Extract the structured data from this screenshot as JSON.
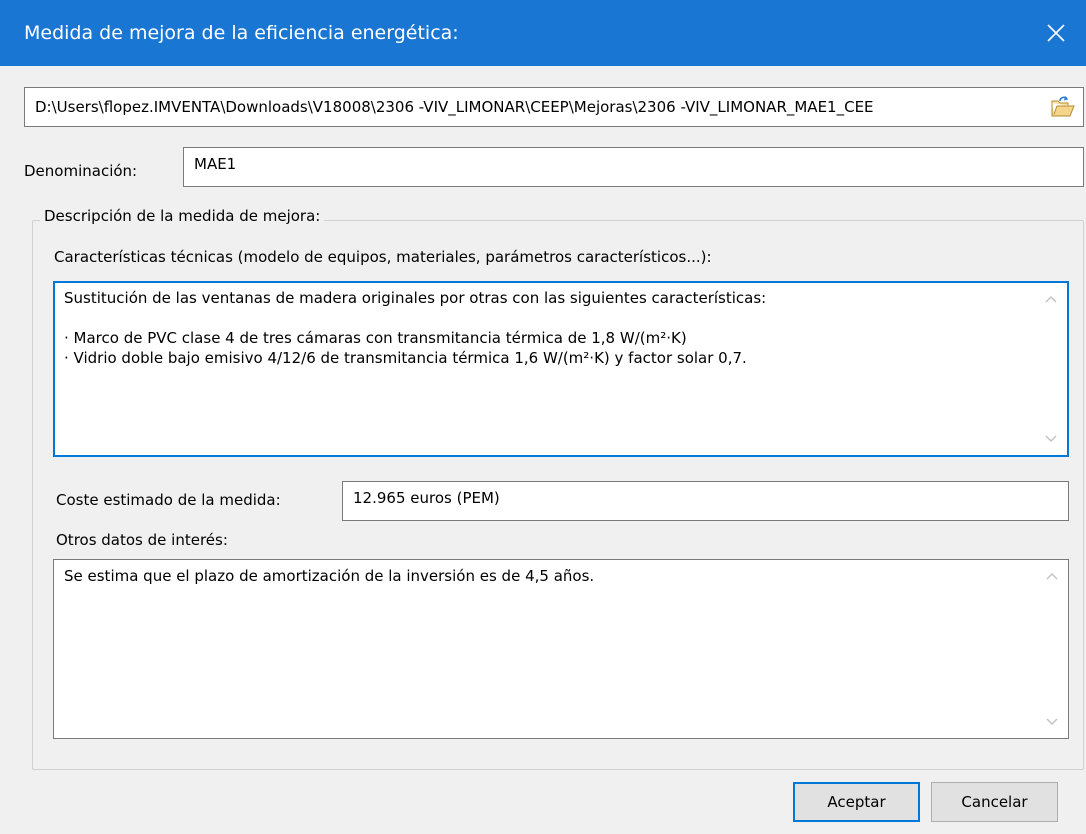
{
  "window": {
    "title": "Medida de mejora de la eficiencia energética:",
    "close_icon": "close-icon",
    "accent_color": "#1976d2"
  },
  "path": {
    "value": "D:\\Users\\flopez.IMVENTA\\Downloads\\V18008\\2306 -VIV_LIMONAR\\CEEP\\Mejoras\\2306 -VIV_LIMONAR_MAE1_CEE",
    "browse_icon": "folder-open-icon"
  },
  "denominacion": {
    "label": "Denominación:",
    "value": "MAE1"
  },
  "descripcion": {
    "group_title": "Descripción de la medida de mejora:",
    "caracteristicas_label": "Características técnicas (modelo de equipos, materiales, parámetros característicos...):",
    "caracteristicas_lines": [
      "Sustitución de las ventanas de madera originales por otras con las siguientes características:",
      "",
      "· Marco de PVC clase 4 de tres cámaras con transmitancia térmica de 1,8 W/(m²·K)",
      "· Vidrio doble bajo emisivo 4/12/6 de transmitancia térmica 1,6 W/(m²·K) y factor solar 0,7."
    ],
    "coste_label": "Coste estimado de la medida:",
    "coste_value": "12.965 euros (PEM)",
    "otros_label": "Otros datos de interés:",
    "otros_lines": [
      "Se estima que el plazo de amortización de la inversión es de 4,5 años."
    ]
  },
  "buttons": {
    "accept": "Aceptar",
    "cancel": "Cancelar"
  }
}
